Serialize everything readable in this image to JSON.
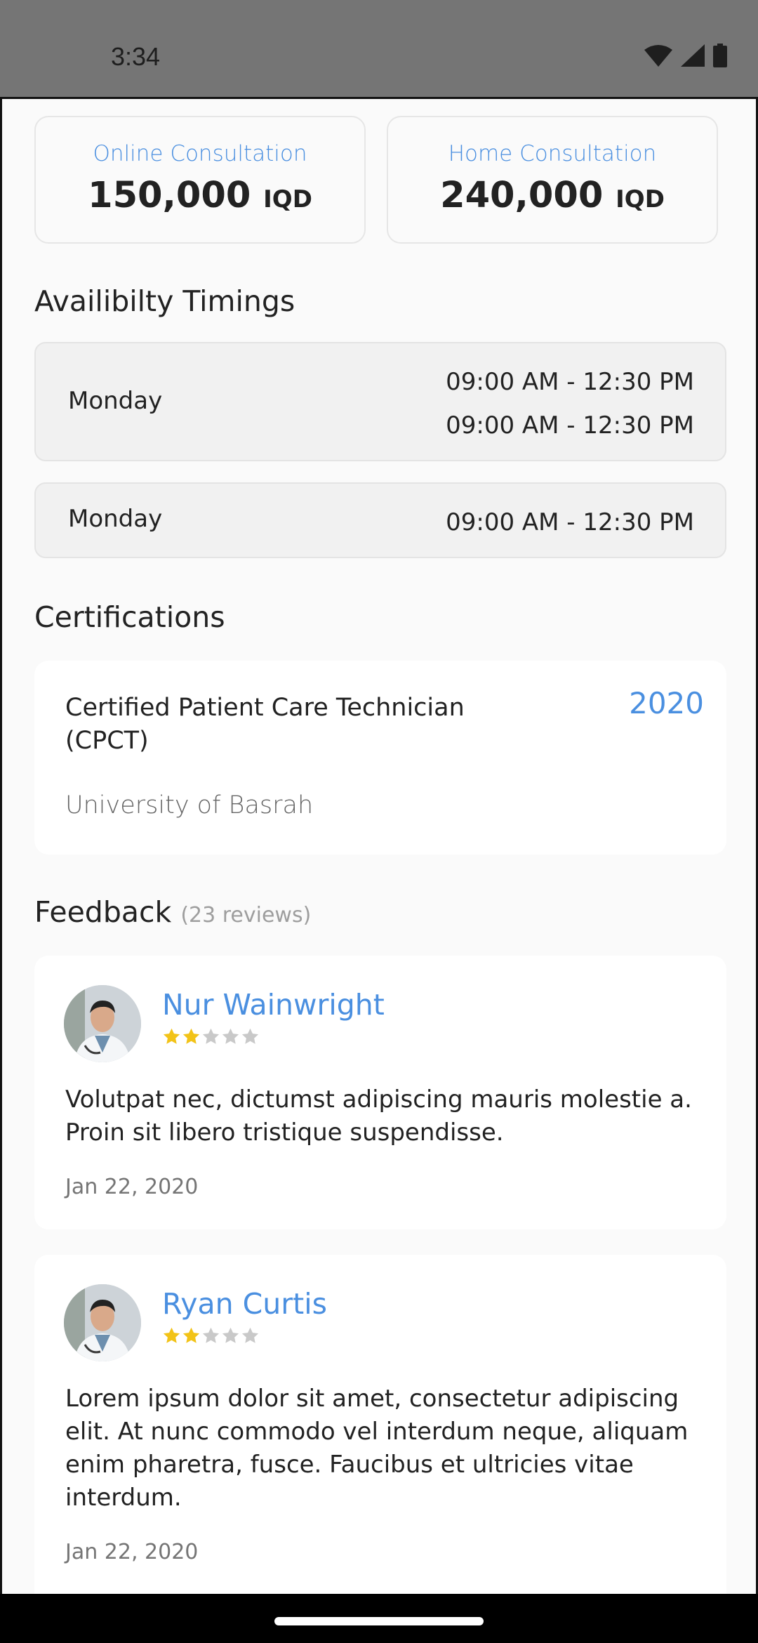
{
  "status_bar": {
    "time": "3:34"
  },
  "pricing": [
    {
      "label": "Online Consultation",
      "amount": "150,000",
      "currency": "IQD"
    },
    {
      "label": "Home Consultation",
      "amount": "240,000",
      "currency": "IQD"
    }
  ],
  "availability": {
    "title": "Availibilty Timings",
    "rows": [
      {
        "day": "Monday",
        "slots": [
          "09:00 AM - 12:30 PM",
          "09:00 AM - 12:30 PM"
        ]
      },
      {
        "day": "Monday",
        "slots": [
          "09:00 AM - 12:30 PM"
        ]
      }
    ]
  },
  "certifications": {
    "title": "Certifications",
    "items": [
      {
        "name": "Certified Patient Care Technician (CPCT)",
        "year": "2020",
        "institution": "University of Basrah"
      }
    ]
  },
  "feedback": {
    "title": "Feedback",
    "count_label": "(23 reviews)",
    "reviews": [
      {
        "name": "Nur Wainwright",
        "rating": 2,
        "rating_max": 5,
        "text": " Volutpat nec, dictumst adipiscing mauris molestie a. Proin sit libero tristique suspendisse.",
        "date": "Jan 22, 2020"
      },
      {
        "name": "Ryan Curtis",
        "rating": 2,
        "rating_max": 5,
        "text": "Lorem ipsum dolor sit amet, consectetur adipiscing elit. At nunc commodo vel interdum neque, aliquam enim pharetra, fusce. Faucibus et ultricies vitae interdum.",
        "date": "Jan 22, 2020"
      }
    ]
  },
  "colors": {
    "accent": "#4a8fe0",
    "star_filled": "#f2c318",
    "star_empty": "#c9c9c9"
  },
  "icons": [
    "wifi-icon",
    "signal-icon",
    "battery-icon",
    "star-icon"
  ]
}
